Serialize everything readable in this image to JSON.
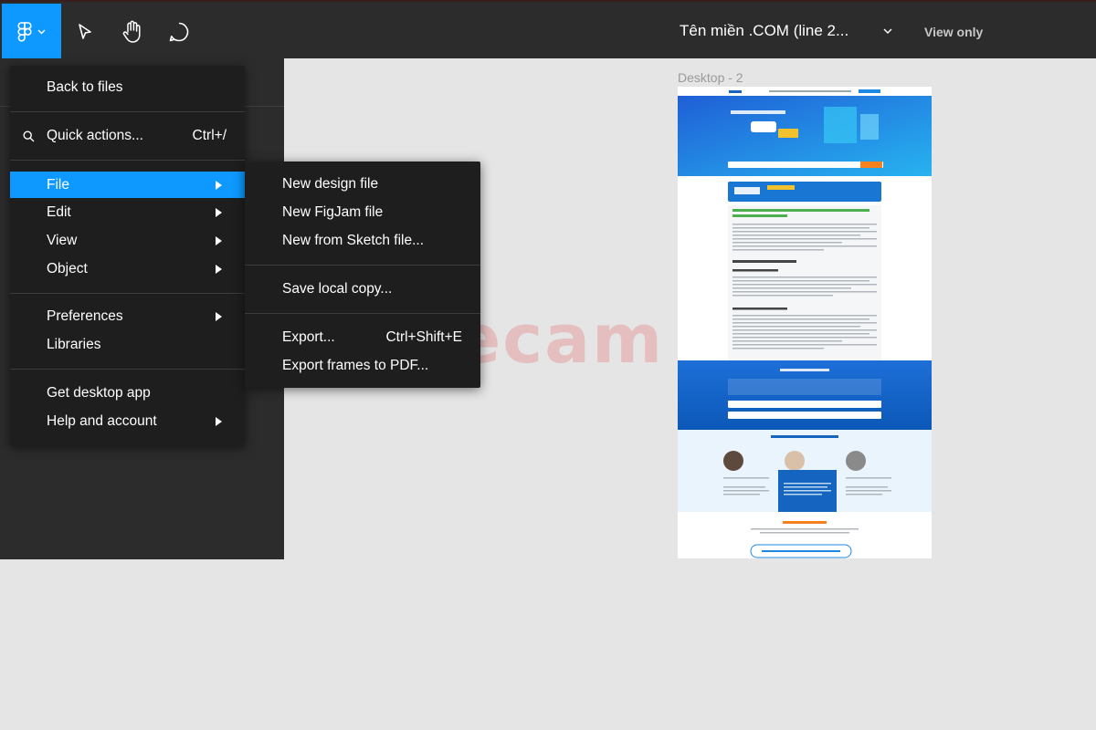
{
  "toolbar": {
    "file_title": "Tên miền .COM (line 2...",
    "view_only": "View only",
    "icons": [
      "figma-logo-icon",
      "chevron-down-icon",
      "move-tool-icon",
      "hand-tool-icon",
      "comment-icon"
    ]
  },
  "main_menu": {
    "back_to_files": "Back to files",
    "quick_actions": {
      "label": "Quick actions...",
      "shortcut": "Ctrl+/"
    },
    "file": "File",
    "edit": "Edit",
    "view": "View",
    "object": "Object",
    "preferences": "Preferences",
    "libraries": "Libraries",
    "get_desktop_app": "Get desktop app",
    "help_and_account": "Help and account"
  },
  "file_submenu": {
    "new_design_file": "New design file",
    "new_figjam_file": "New FigJam file",
    "new_from_sketch": "New from Sketch file...",
    "save_local_copy": "Save local copy...",
    "export": {
      "label": "Export...",
      "shortcut": "Ctrl+Shift+E"
    },
    "export_frames_pdf": "Export frames to PDF..."
  },
  "canvas": {
    "frame_label": "Desktop - 2"
  },
  "watermark": "cónhecam",
  "colors": {
    "accent": "#0d99ff",
    "toolbar_bg": "#2c2c2c",
    "menu_bg": "#1e1e1e",
    "canvas_bg": "#e5e5e5"
  }
}
